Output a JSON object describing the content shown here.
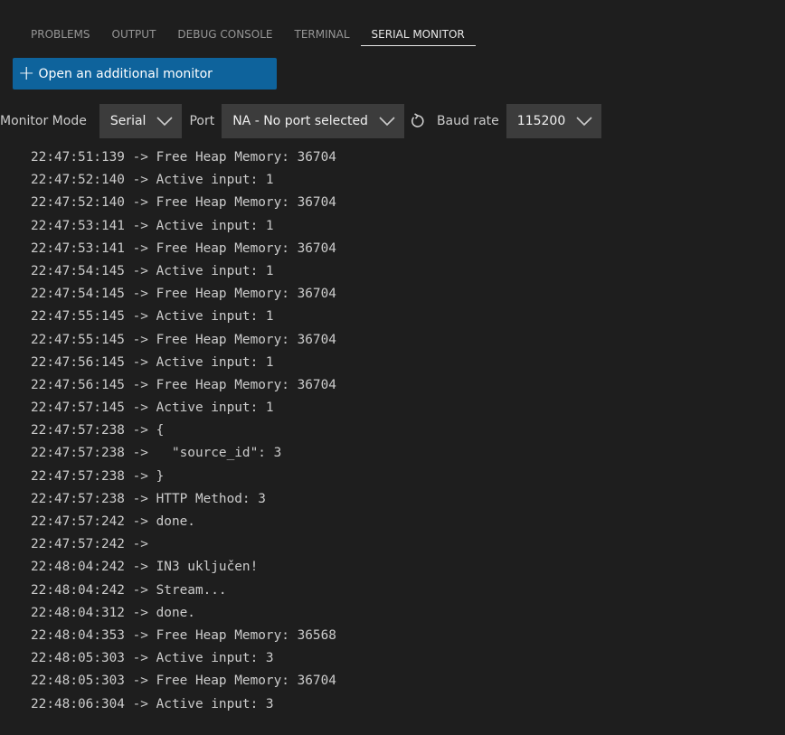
{
  "tabs": [
    {
      "label": "PROBLEMS"
    },
    {
      "label": "OUTPUT"
    },
    {
      "label": "DEBUG CONSOLE"
    },
    {
      "label": "TERMINAL"
    },
    {
      "label": "SERIAL MONITOR"
    }
  ],
  "active_tab": "SERIAL MONITOR",
  "open_monitor_button": {
    "icon": "plus-icon",
    "label": "Open an additional monitor"
  },
  "controls": {
    "monitor_mode_label": "Monitor Mode",
    "monitor_mode_value": "Serial",
    "port_label": "Port",
    "port_value": "NA - No port selected",
    "baud_label": "Baud rate",
    "baud_value": "115200"
  },
  "colors": {
    "background": "#1e1e1e",
    "button": "#0e639c",
    "select_bg": "#3c3c3c"
  },
  "log_lines": [
    "22:47:51:139 -> Free Heap Memory: 36704",
    "22:47:52:140 -> Active input: 1",
    "22:47:52:140 -> Free Heap Memory: 36704",
    "22:47:53:141 -> Active input: 1",
    "22:47:53:141 -> Free Heap Memory: 36704",
    "22:47:54:145 -> Active input: 1",
    "22:47:54:145 -> Free Heap Memory: 36704",
    "22:47:55:145 -> Active input: 1",
    "22:47:55:145 -> Free Heap Memory: 36704",
    "22:47:56:145 -> Active input: 1",
    "22:47:56:145 -> Free Heap Memory: 36704",
    "22:47:57:145 -> Active input: 1",
    "22:47:57:238 -> {",
    "22:47:57:238 ->   \"source_id\": 3",
    "22:47:57:238 -> }",
    "22:47:57:238 -> HTTP Method: 3",
    "22:47:57:242 -> done.",
    "22:47:57:242 ->",
    "22:48:04:242 -> IN3 uključen!",
    "22:48:04:242 -> Stream...",
    "22:48:04:312 -> done.",
    "22:48:04:353 -> Free Heap Memory: 36568",
    "22:48:05:303 -> Active input: 3",
    "22:48:05:303 -> Free Heap Memory: 36704",
    "22:48:06:304 -> Active input: 3"
  ]
}
